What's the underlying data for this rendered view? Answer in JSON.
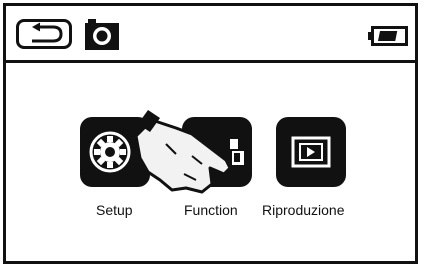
{
  "statusbar": {
    "back_icon": "back-arrow-icon",
    "camera_icon": "camera-icon",
    "battery_icon": "battery-icon",
    "battery_level": 0.75
  },
  "menu": {
    "items": [
      {
        "label": "Setup",
        "icon": "gear-icon"
      },
      {
        "label": "Function",
        "icon": "function-icon"
      },
      {
        "label": "Riproduzione",
        "icon": "playback-icon"
      }
    ]
  },
  "overlay": {
    "icon": "pointing-hand-icon"
  },
  "colors": {
    "foreground": "#111111",
    "background": "#ffffff"
  }
}
